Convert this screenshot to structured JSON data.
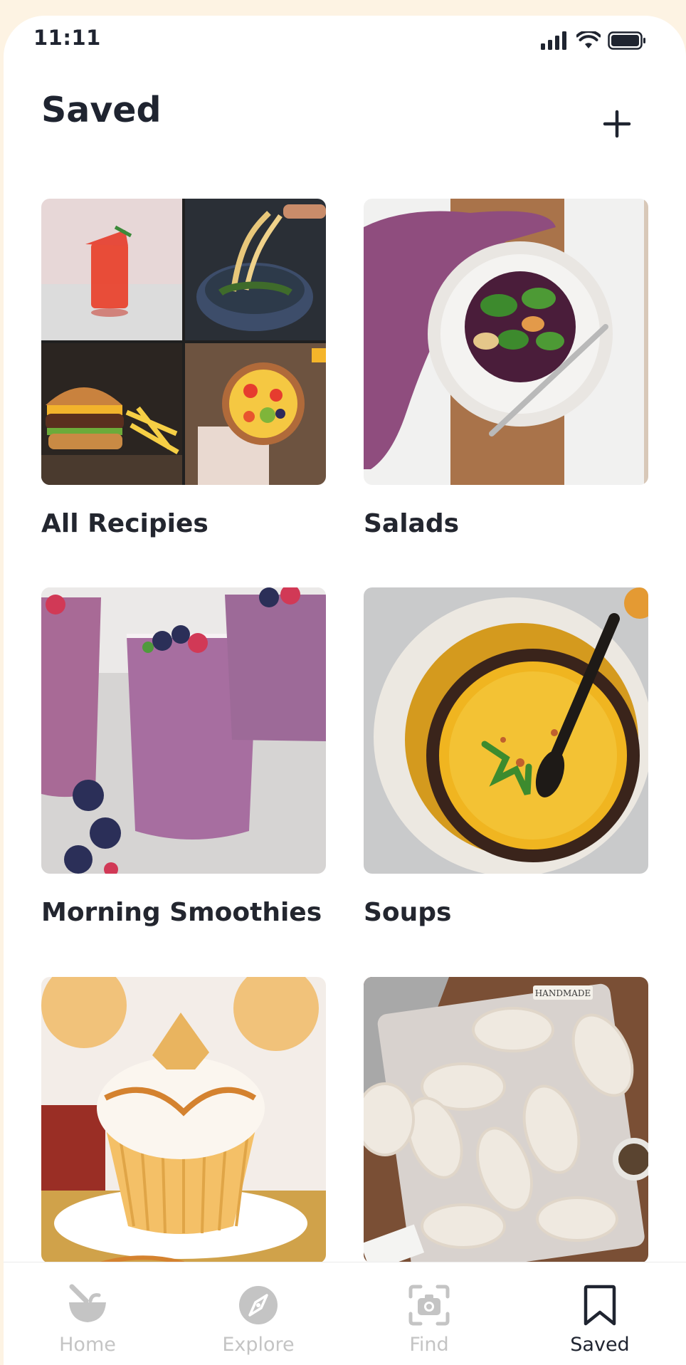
{
  "status_bar": {
    "time": "11:11"
  },
  "header": {
    "title": "Saved"
  },
  "collections": [
    {
      "label": "All Recipies"
    },
    {
      "label": "Salads"
    },
    {
      "label": "Morning Smoothies"
    },
    {
      "label": "Soups"
    },
    {
      "label": ""
    },
    {
      "label": "",
      "photo_text": "HANDMADE"
    }
  ],
  "tabs": [
    {
      "label": "Home",
      "icon": "bowl-icon",
      "active": false
    },
    {
      "label": "Explore",
      "icon": "compass-icon",
      "active": false
    },
    {
      "label": "Find",
      "icon": "scan-camera-icon",
      "active": false
    },
    {
      "label": "Saved",
      "icon": "bookmark-icon",
      "active": true
    }
  ],
  "colors": {
    "active": "#1f2430",
    "inactive": "#c4c4c4",
    "background": "#fdf3e3"
  }
}
